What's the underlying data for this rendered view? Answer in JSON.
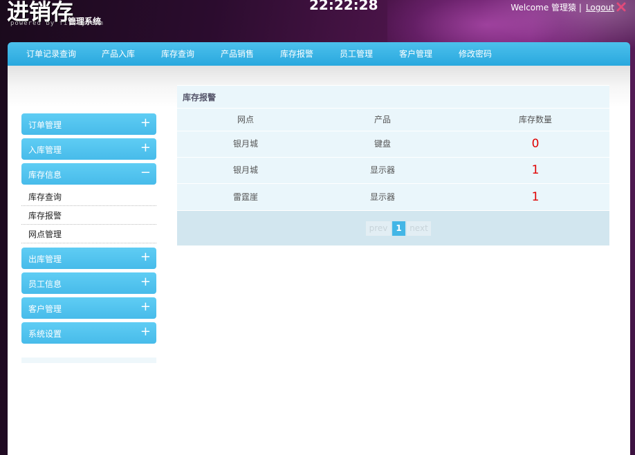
{
  "header": {
    "logo_main": "进销存",
    "logo_sub": "管理系统",
    "powered": "powered  by  firday.com",
    "clock": "22:22:28",
    "welcome": "Welcome 管理猿 |",
    "logout": "Logout"
  },
  "nav": {
    "items": [
      "订单记录查询",
      "产品入库",
      "库存查询",
      "产品销售",
      "库存报警",
      "员工管理",
      "客户管理",
      "修改密码"
    ]
  },
  "sidebar": {
    "groups": [
      {
        "label": "订单管理",
        "sign": "+"
      },
      {
        "label": "入库管理",
        "sign": "+"
      },
      {
        "label": "库存信息",
        "sign": "−"
      },
      {
        "label": "出库管理",
        "sign": "+"
      },
      {
        "label": "员工信息",
        "sign": "+"
      },
      {
        "label": "客户管理",
        "sign": "+"
      },
      {
        "label": "系统设置",
        "sign": "+"
      }
    ],
    "sub_items": [
      "库存查询",
      "库存报警",
      "网点管理"
    ]
  },
  "panel": {
    "title": "库存报警",
    "columns": [
      "网点",
      "产品",
      "库存数量"
    ],
    "rows": [
      [
        "银月城",
        "键盘",
        "0"
      ],
      [
        "银月城",
        "显示器",
        "1"
      ],
      [
        "雷霆崖",
        "显示器",
        "1"
      ]
    ],
    "pager": {
      "prev": "prev",
      "page": "1",
      "next": "next"
    }
  },
  "colors": {
    "nav_bar": "#29a8de",
    "side_button": "#47bbea",
    "qty_alert": "#e00000"
  }
}
